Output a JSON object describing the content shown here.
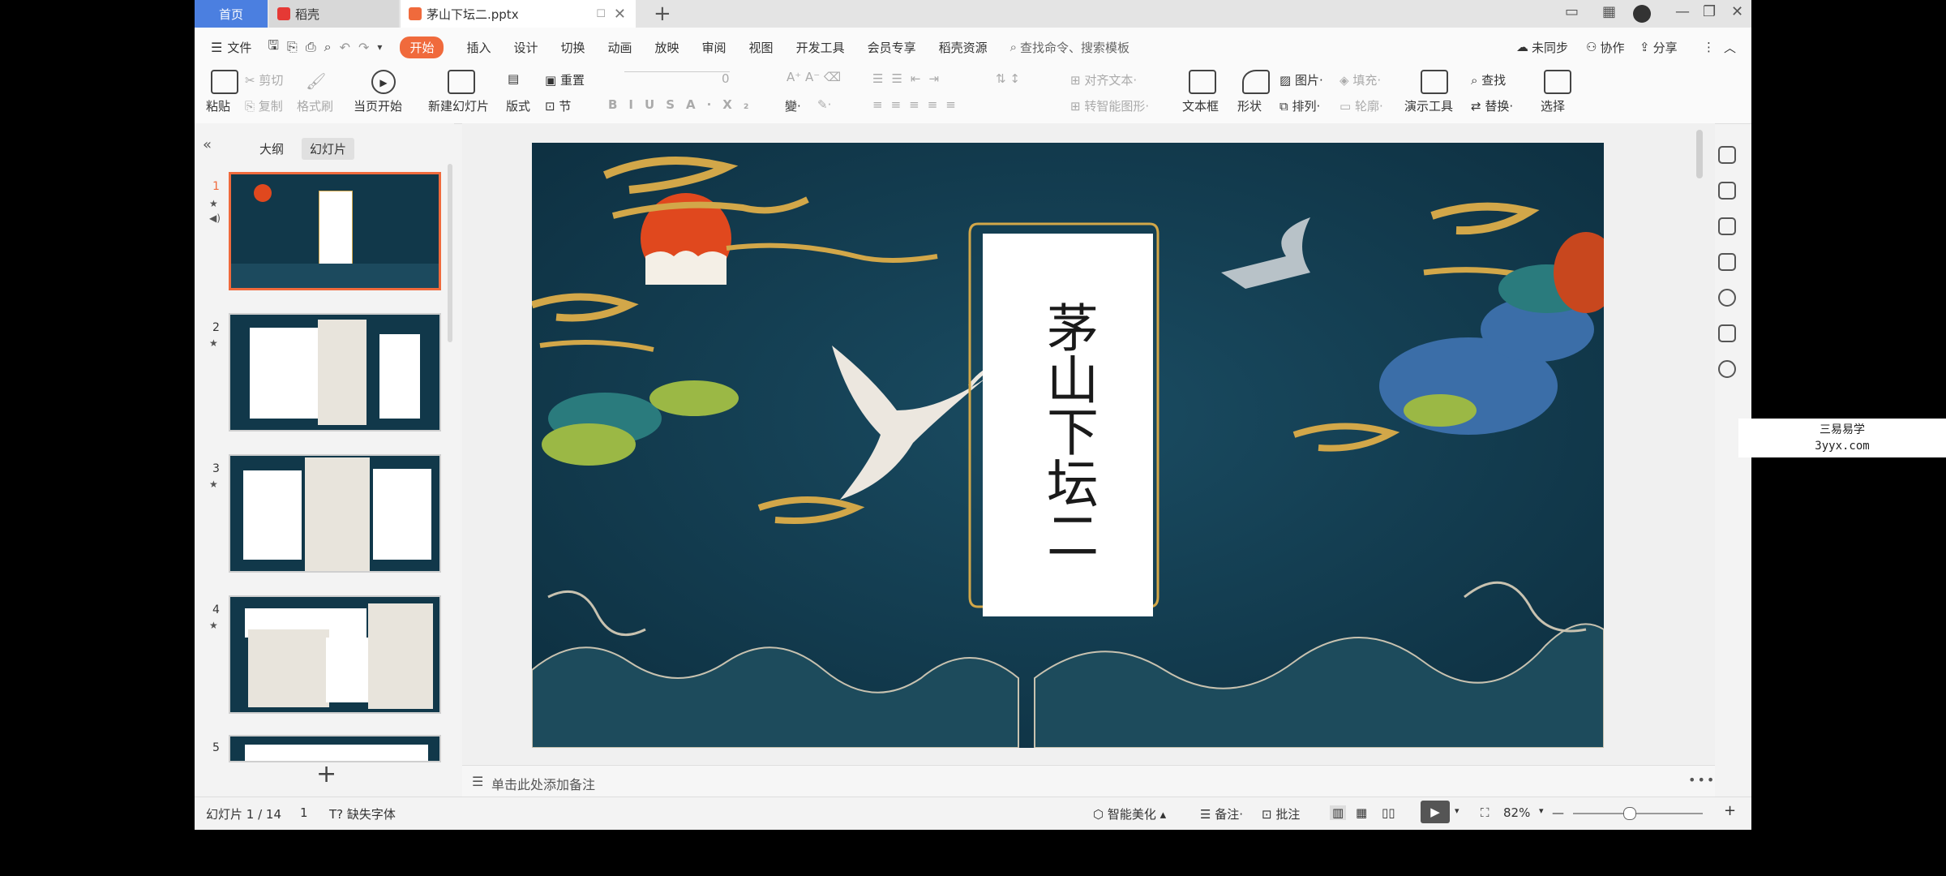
{
  "tabs": {
    "home": "首页",
    "daoke": "稻壳",
    "doc": "茅山下坛二.pptx"
  },
  "menu": {
    "file": "文件",
    "items": [
      "开始",
      "插入",
      "设计",
      "切换",
      "动画",
      "放映",
      "审阅",
      "视图",
      "开发工具",
      "会员专享",
      "稻壳资源"
    ],
    "search": "查找命令、搜索模板",
    "sync": "未同步",
    "collab": "协作",
    "share": "分享"
  },
  "ribbon": {
    "paste": "粘贴",
    "cut": "剪切",
    "copy": "复制",
    "format_painter": "格式刷",
    "from_current": "当页开始",
    "new_slide": "新建幻灯片",
    "layout": "版式",
    "section": "节",
    "reset": "重置",
    "font_size": "0",
    "align_text": "对齐文本",
    "smartart": "转智能图形",
    "textbox": "文本框",
    "shape": "形状",
    "picture": "图片",
    "fill": "填充",
    "arrange": "排列",
    "outline": "轮廓",
    "present_tools": "演示工具",
    "find": "查找",
    "replace": "替换",
    "select": "选择"
  },
  "panel": {
    "outline_tab": "大纲",
    "slides_tab": "幻灯片",
    "slide_numbers": [
      "1",
      "2",
      "3",
      "4",
      "5"
    ]
  },
  "slide": {
    "title": "茅山下坛二"
  },
  "notes_placeholder": "单击此处添加备注",
  "status": {
    "slide_pos": "幻灯片 1 / 14",
    "page": "1",
    "missing_font": "缺失字体",
    "smart_beautify": "智能美化",
    "notes": "备注",
    "comments": "批注",
    "zoom": "82%"
  },
  "watermark": {
    "line1": "三易易学",
    "line2": "3yyx.com"
  },
  "colors": {
    "accent": "#f06a3c",
    "home_tab": "#4b7fe0",
    "slide_bg": "#12384c",
    "gold": "#d2a749",
    "sun": "#e0481e"
  }
}
